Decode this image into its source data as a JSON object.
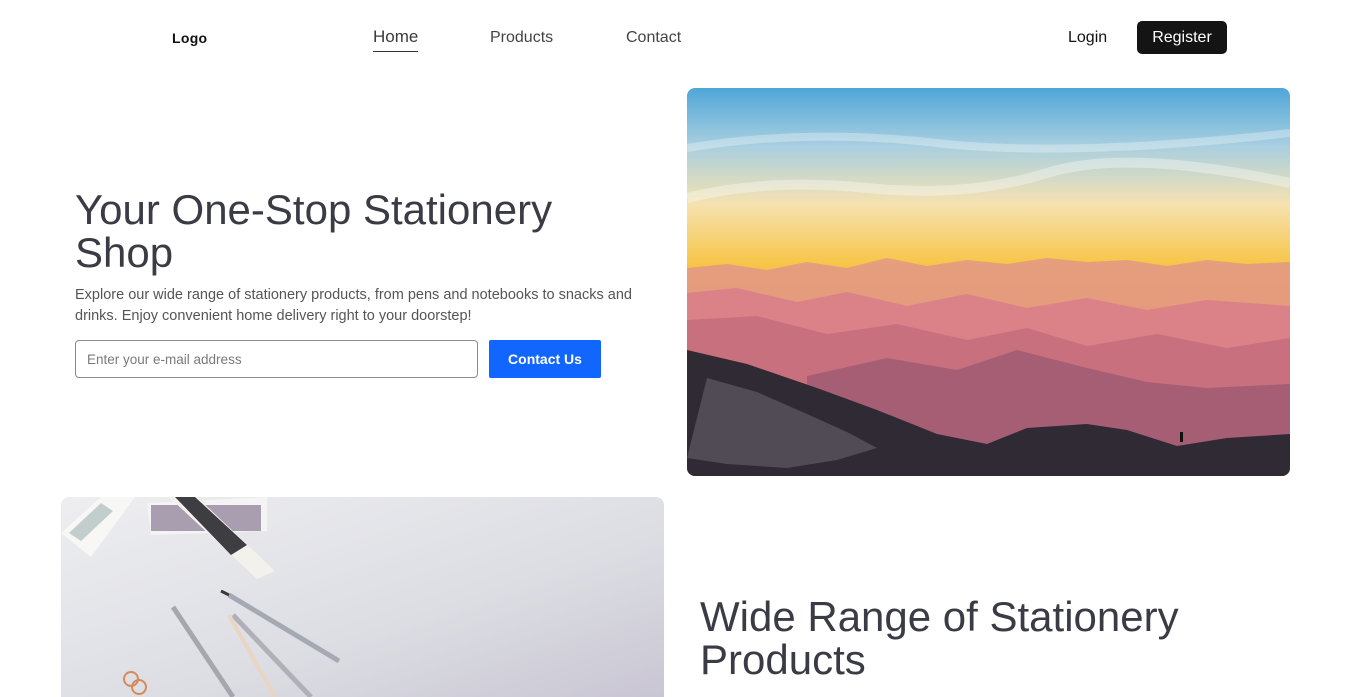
{
  "nav": {
    "logo": "Logo",
    "links": [
      "Home",
      "Products",
      "Contact"
    ],
    "login": "Login",
    "register": "Register"
  },
  "hero": {
    "title": "Your One-Stop Stationery Shop",
    "description": "Explore our wide range of stationery products, from pens and notebooks to snacks and drinks. Enjoy convenient home delivery right to your doorstep!",
    "email_placeholder": "Enter your e-mail address",
    "cta": "Contact Us"
  },
  "section2": {
    "title": "Wide Range of Stationery Products"
  }
}
